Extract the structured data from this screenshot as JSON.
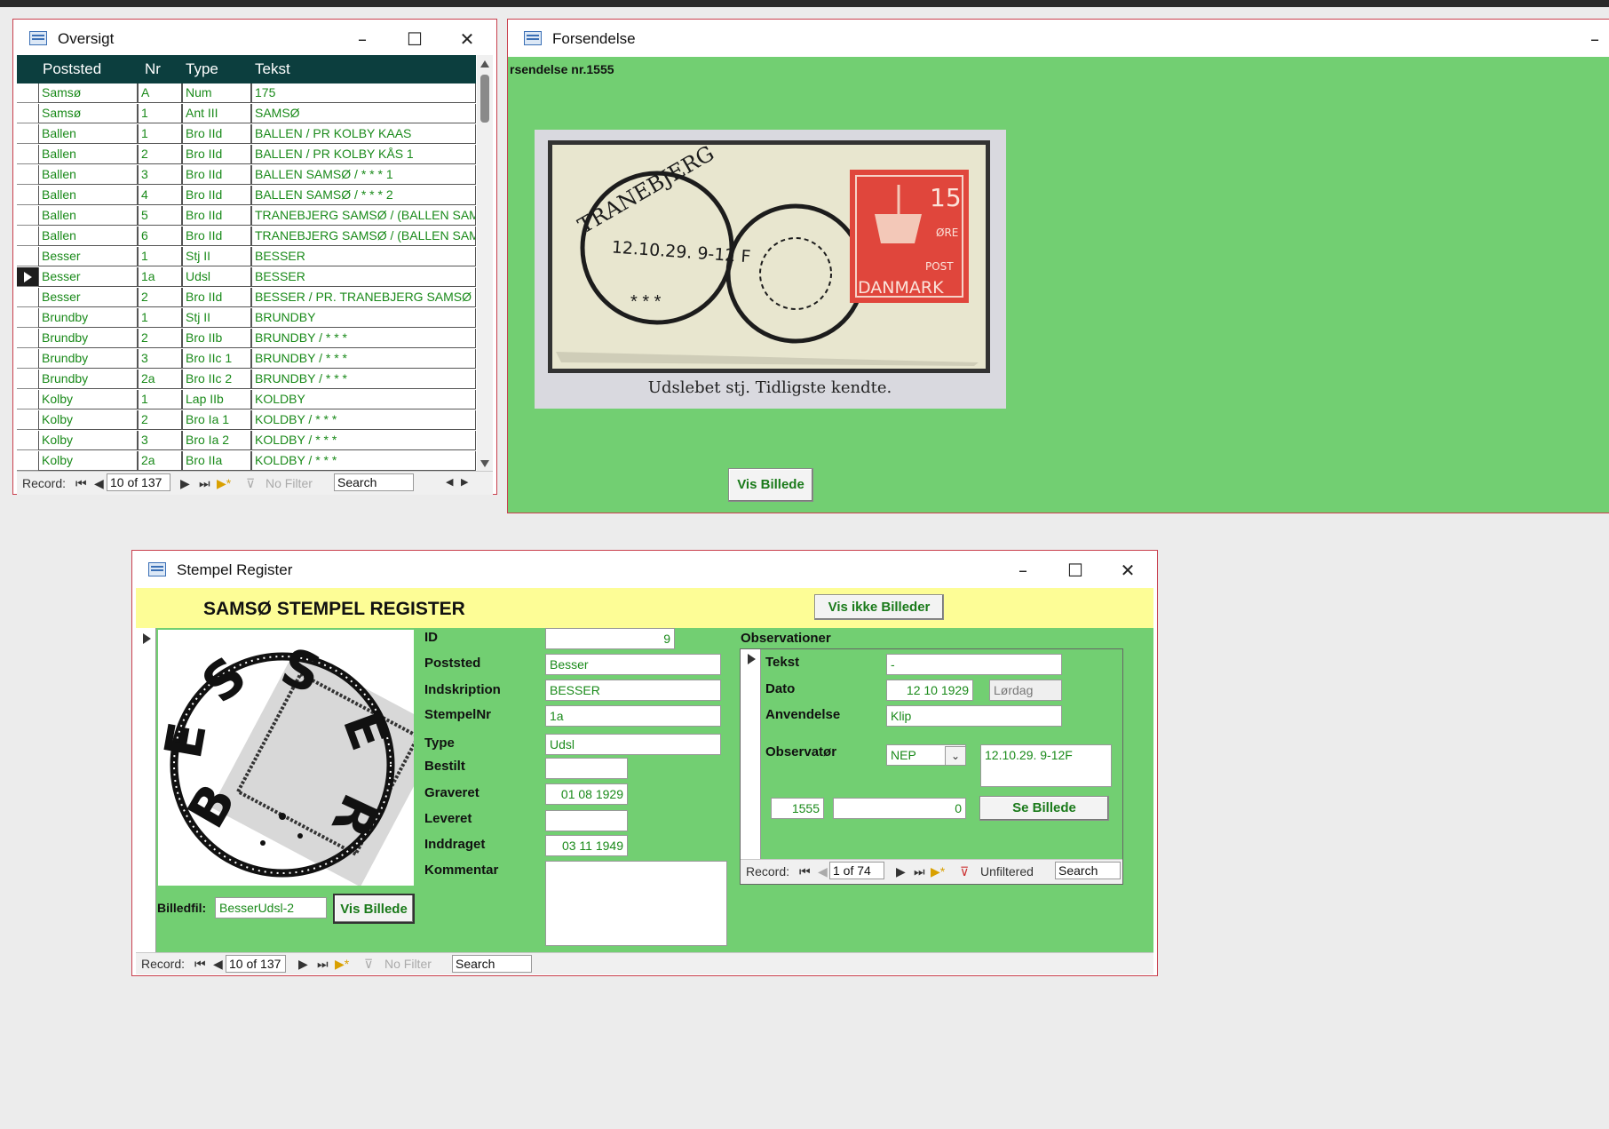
{
  "oversigt": {
    "title": "Oversigt",
    "columns": [
      "Poststed",
      "Nr",
      "Type",
      "Tekst"
    ],
    "rows": [
      [
        "Samsø",
        "A",
        "Num",
        "175"
      ],
      [
        "Samsø",
        "1",
        "Ant III",
        "SAMSØ"
      ],
      [
        "Ballen",
        "1",
        "Bro IId",
        "BALLEN / PR KOLBY KAAS"
      ],
      [
        "Ballen",
        "2",
        "Bro IId",
        "BALLEN / PR KOLBY KÅS 1"
      ],
      [
        "Ballen",
        "3",
        "Bro IId",
        "BALLEN SAMSØ / * * * 1"
      ],
      [
        "Ballen",
        "4",
        "Bro IId",
        "BALLEN SAMSØ / * * * 2"
      ],
      [
        "Ballen",
        "5",
        "Bro IId",
        "TRANEBJERG SAMSØ / (BALLEN SAMS"
      ],
      [
        "Ballen",
        "6",
        "Bro IId",
        "TRANEBJERG SAMSØ / (BALLEN SAMS"
      ],
      [
        "Besser",
        "1",
        "Stj II",
        "BESSER"
      ],
      [
        "Besser",
        "1a",
        "Udsl",
        "BESSER"
      ],
      [
        "Besser",
        "2",
        "Bro IId",
        "BESSER / PR. TRANEBJERG SAMSØ"
      ],
      [
        "Brundby",
        "1",
        "Stj II",
        "BRUNDBY"
      ],
      [
        "Brundby",
        "2",
        "Bro IIb",
        "BRUNDBY / * * *"
      ],
      [
        "Brundby",
        "3",
        "Bro IIc 1",
        "BRUNDBY / * * *"
      ],
      [
        "Brundby",
        "2a",
        "Bro IIc 2",
        "BRUNDBY / * * *"
      ],
      [
        "Kolby",
        "1",
        "Lap IIb",
        "KOLDBY"
      ],
      [
        "Kolby",
        "2",
        "Bro Ia 1",
        "KOLDBY / * * *"
      ],
      [
        "Kolby",
        "3",
        "Bro Ia 2",
        "KOLDBY / * * *"
      ],
      [
        "Kolby",
        "2a",
        "Bro IIa",
        "KOLDBY / * * *"
      ]
    ],
    "nav": {
      "label": "Record:",
      "position": "10 of 137",
      "filter": "No Filter",
      "search": "Search"
    }
  },
  "forsendelse": {
    "title": "Forsendelse",
    "heading": "rsendelse nr.1555",
    "stamp_caption": "Udslebet stj. Tidligste kendte.",
    "postmark_text": "TRANEBJERG",
    "postmark_date": "12.10.29. 9-12 F",
    "stamp_value": "15",
    "stamp_unit": "ØRE",
    "stamp_post": "POST",
    "stamp_country": "DANMARK",
    "button": "Vis Billede"
  },
  "register": {
    "title": "Stempel Register",
    "header_title": "SAMSØ STEMPEL REGISTER",
    "toggle_button": "Vis ikke Billeder",
    "image_file_label": "Billedfil:",
    "image_file_value": "BesserUdsl-2",
    "image_button": "Vis Billede",
    "fields": {
      "id_label": "ID",
      "id": "9",
      "poststed_label": "Poststed",
      "poststed": "Besser",
      "indskription_label": "Indskription",
      "indskription": "BESSER",
      "stempelnr_label": "StempelNr",
      "stempelnr": "1a",
      "type_label": "Type",
      "type": "Udsl",
      "bestilt_label": "Bestilt",
      "bestilt": "",
      "graveret_label": "Graveret",
      "graveret": "01 08 1929",
      "leveret_label": "Leveret",
      "leveret": "",
      "inddraget_label": "Inddraget",
      "inddraget": "03 11 1949",
      "kommentar_label": "Kommentar",
      "kommentar": ""
    },
    "observations": {
      "heading": "Observationer",
      "tekst_label": "Tekst",
      "tekst": "-",
      "dato_label": "Dato",
      "dato": "12 10 1929",
      "weekday": "Lørdag",
      "anvendelse_label": "Anvendelse",
      "anvendelse": "Klip",
      "observator_label": "Observatør",
      "observator": "NEP",
      "note": "12.10.29. 9-12F",
      "shipment_nr": "1555",
      "count": "0",
      "image_button": "Se Billede",
      "nav": {
        "label": "Record:",
        "position": "1 of 74",
        "filter": "Unfiltered",
        "search": "Search"
      }
    },
    "nav": {
      "label": "Record:",
      "position": "10 of 137",
      "filter": "No Filter",
      "search": "Search"
    }
  }
}
